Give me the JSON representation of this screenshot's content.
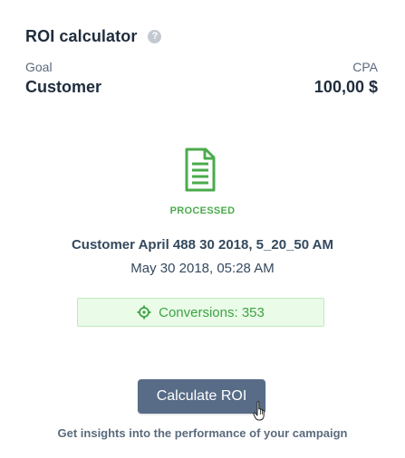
{
  "header": {
    "title": "ROI calculator",
    "help_icon": "question-icon",
    "help_glyph": "?"
  },
  "goal": {
    "label": "Goal",
    "value": "Customer"
  },
  "cpa": {
    "label": "CPA",
    "value": "100,00 $"
  },
  "record": {
    "status_icon": "document-icon",
    "status": "PROCESSED",
    "name": "Customer April 488 30 2018, 5_20_50 AM",
    "date": "May 30 2018, 05:28 AM"
  },
  "conversions": {
    "icon": "crosshair-icon",
    "text": "Conversions: 353"
  },
  "action": {
    "button_label": "Calculate ROI",
    "hint": "Get insights into the performance of your campaign"
  },
  "colors": {
    "accent_green": "#4aab4c",
    "button_bg": "#586c87",
    "conversions_bg": "#eafbe8"
  }
}
